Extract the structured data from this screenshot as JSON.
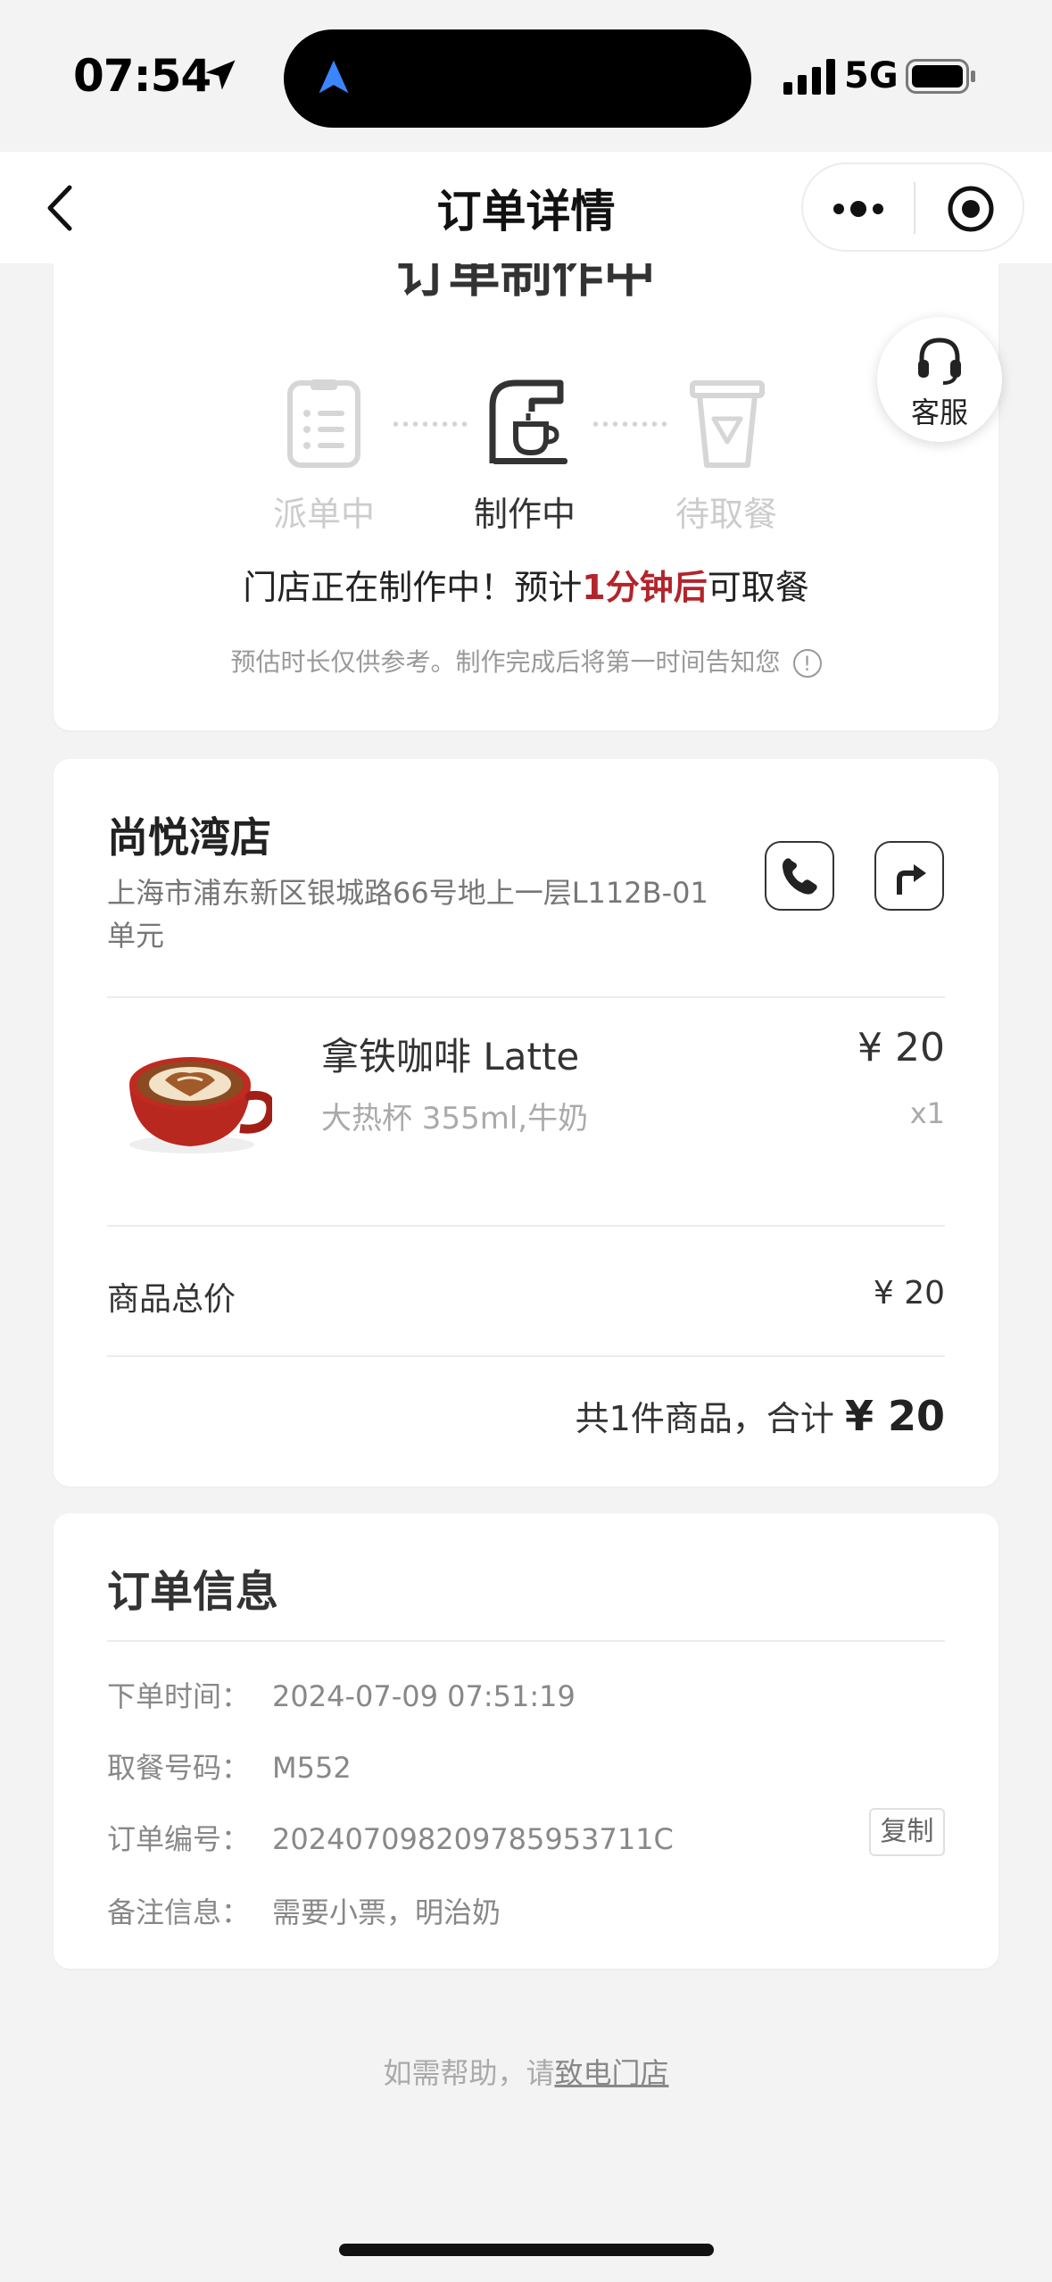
{
  "status_bar": {
    "time": "07:54",
    "network": "5G",
    "icons": [
      "location-arrow-icon",
      "signal-bars-icon",
      "battery-icon"
    ]
  },
  "nav": {
    "title": "订单详情",
    "back_icon": "chevron-left-icon",
    "more_icon": "more-dots-icon",
    "close_icon": "target-close-icon"
  },
  "progress": {
    "clipped_title": "订单制作中",
    "steps": [
      {
        "label": "派单中",
        "icon": "clipboard-list-icon",
        "active": false
      },
      {
        "label": "制作中",
        "icon": "coffee-machine-icon",
        "active": true
      },
      {
        "label": "待取餐",
        "icon": "takeaway-cup-icon",
        "active": false
      }
    ],
    "status_prefix": "门店正在制作中！预计",
    "status_highlight": "1分钟后",
    "status_suffix": "可取餐",
    "hint": "预估时长仅供参考。制作完成后将第一时间告知您",
    "hint_icon": "info-icon",
    "colors": {
      "highlight": "#b3242b",
      "inactive": "#cccccc"
    }
  },
  "service_button": {
    "label": "客服",
    "icon": "headset-icon"
  },
  "store": {
    "name": "尚悦湾店",
    "address": "上海市浦东新区银城路66号地上一层L112B-01单元",
    "call_icon": "phone-icon",
    "nav_icon": "route-arrow-icon"
  },
  "product": {
    "name": "拿铁咖啡 Latte",
    "spec": "大热杯 355ml,牛奶",
    "price": "¥ 20",
    "qty": "x1",
    "image": "latte-cup-image"
  },
  "summary": {
    "subtotal_label": "商品总价",
    "subtotal_value": "¥ 20",
    "total_prefix": "共1件商品，合计",
    "total_amount": "¥ 20"
  },
  "order_info": {
    "title": "订单信息",
    "rows": [
      {
        "key": "下单时间：",
        "value": "2024-07-09 07:51:19"
      },
      {
        "key": "取餐号码：",
        "value": "M552"
      },
      {
        "key": "订单编号：",
        "value": "20240709820978595371​1C"
      },
      {
        "key": "备注信息：",
        "value": "需要小票，明治奶"
      }
    ],
    "copy_label": "复制"
  },
  "help": {
    "prefix": "如需帮助，请",
    "link": "致电门店"
  }
}
